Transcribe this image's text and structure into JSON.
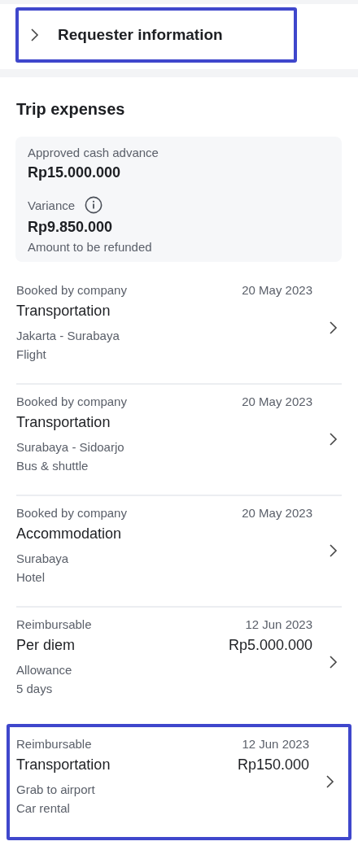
{
  "requester_section": {
    "title": "Requester information",
    "expanded": false,
    "highlighted": true
  },
  "trip_expenses": {
    "title": "Trip expenses",
    "summary": {
      "approved_label": "Approved cash advance",
      "approved_amount": "Rp15.000.000",
      "variance_label": "Variance",
      "variance_amount": "Rp9.850.000",
      "variance_note": "Amount to be refunded"
    },
    "items": [
      {
        "category": "Booked by company",
        "date": "20 May 2023",
        "title": "Transportation",
        "details": [
          "Jakarta - Surabaya",
          "Flight"
        ],
        "highlighted": false
      },
      {
        "category": "Booked by company",
        "date": "20 May 2023",
        "title": "Transportation",
        "details": [
          "Surabaya - Sidoarjo",
          "Bus & shuttle"
        ],
        "highlighted": false
      },
      {
        "category": "Booked by company",
        "date": "20 May 2023",
        "title": "Accommodation",
        "details": [
          "Surabaya",
          "Hotel"
        ],
        "highlighted": false
      },
      {
        "category": "Reimbursable",
        "date": "12 Jun 2023",
        "title": "Per diem",
        "amount": "Rp5.000.000",
        "details": [
          "Allowance",
          "5 days"
        ],
        "highlighted": false
      },
      {
        "category": "Reimbursable",
        "date": "12 Jun 2023",
        "title": "Transportation",
        "amount": "Rp150.000",
        "details": [
          "Grab to airport",
          "Car rental"
        ],
        "highlighted": true
      }
    ]
  }
}
